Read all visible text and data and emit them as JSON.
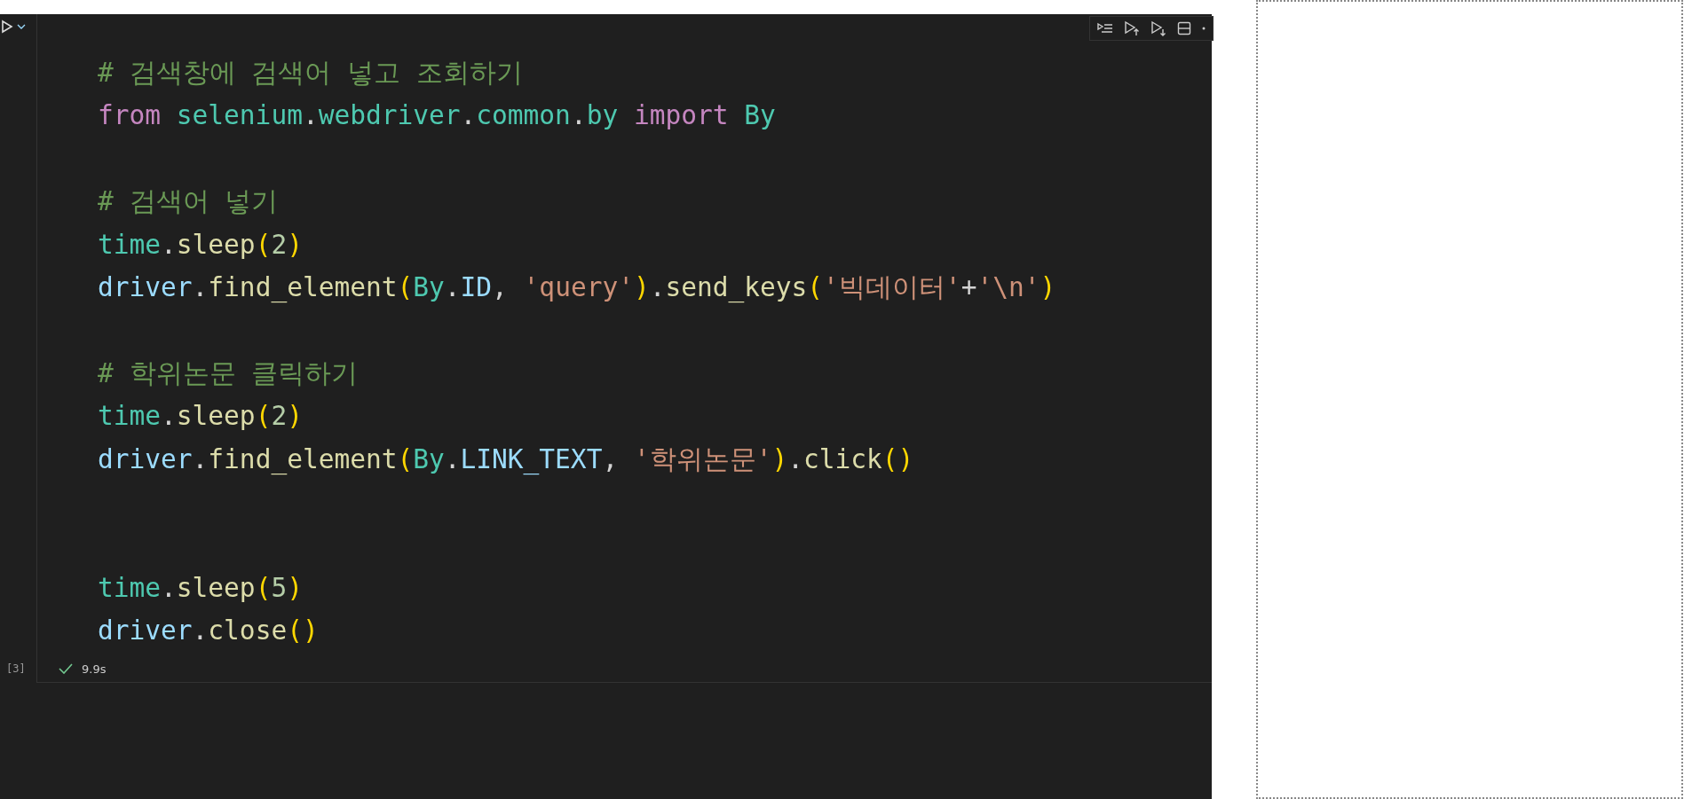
{
  "cell": {
    "execution_count": "[3]",
    "succeeded": true,
    "duration": "9.9s",
    "lines": [
      {
        "kind": "code",
        "tokens": [
          {
            "text": "# 검색창에 검색어 넣고 조회하기",
            "kind": "comment"
          }
        ]
      },
      {
        "kind": "code",
        "tokens": [
          {
            "text": "from ",
            "kind": "keyword"
          },
          {
            "text": "selenium",
            "kind": "module"
          },
          {
            "text": ".",
            "kind": "plain"
          },
          {
            "text": "webdriver",
            "kind": "module"
          },
          {
            "text": ".",
            "kind": "plain"
          },
          {
            "text": "common",
            "kind": "module"
          },
          {
            "text": ".",
            "kind": "plain"
          },
          {
            "text": "by ",
            "kind": "module"
          },
          {
            "text": "import ",
            "kind": "keyword"
          },
          {
            "text": "By",
            "kind": "module"
          }
        ]
      },
      {
        "kind": "blank"
      },
      {
        "kind": "code",
        "tokens": [
          {
            "text": "# 검색어 넣기",
            "kind": "comment"
          }
        ]
      },
      {
        "kind": "code",
        "tokens": [
          {
            "text": "time",
            "kind": "module"
          },
          {
            "text": ".",
            "kind": "plain"
          },
          {
            "text": "sleep",
            "kind": "function"
          },
          {
            "text": "(",
            "kind": "paren"
          },
          {
            "text": "2",
            "kind": "number"
          },
          {
            "text": ")",
            "kind": "paren"
          }
        ]
      },
      {
        "kind": "code",
        "tokens": [
          {
            "text": "driver",
            "kind": "variable"
          },
          {
            "text": ".",
            "kind": "plain"
          },
          {
            "text": "find_element",
            "kind": "function"
          },
          {
            "text": "(",
            "kind": "paren"
          },
          {
            "text": "By",
            "kind": "module"
          },
          {
            "text": ".",
            "kind": "plain"
          },
          {
            "text": "ID",
            "kind": "variable"
          },
          {
            "text": ", ",
            "kind": "plain"
          },
          {
            "text": "'query'",
            "kind": "string"
          },
          {
            "text": ")",
            "kind": "paren"
          },
          {
            "text": ".",
            "kind": "plain"
          },
          {
            "text": "send_keys",
            "kind": "function"
          },
          {
            "text": "(",
            "kind": "paren"
          },
          {
            "text": "'빅데이터'",
            "kind": "string"
          },
          {
            "text": "+",
            "kind": "plain"
          },
          {
            "text": "'\\n'",
            "kind": "string"
          },
          {
            "text": ")",
            "kind": "paren"
          }
        ]
      },
      {
        "kind": "blank"
      },
      {
        "kind": "code",
        "tokens": [
          {
            "text": "# 학위논문 클릭하기",
            "kind": "comment"
          }
        ]
      },
      {
        "kind": "code",
        "tokens": [
          {
            "text": "time",
            "kind": "module"
          },
          {
            "text": ".",
            "kind": "plain"
          },
          {
            "text": "sleep",
            "kind": "function"
          },
          {
            "text": "(",
            "kind": "paren"
          },
          {
            "text": "2",
            "kind": "number"
          },
          {
            "text": ")",
            "kind": "paren"
          }
        ]
      },
      {
        "kind": "code",
        "tokens": [
          {
            "text": "driver",
            "kind": "variable"
          },
          {
            "text": ".",
            "kind": "plain"
          },
          {
            "text": "find_element",
            "kind": "function"
          },
          {
            "text": "(",
            "kind": "paren"
          },
          {
            "text": "By",
            "kind": "module"
          },
          {
            "text": ".",
            "kind": "plain"
          },
          {
            "text": "LINK_TEXT",
            "kind": "variable"
          },
          {
            "text": ", ",
            "kind": "plain"
          },
          {
            "text": "'학위논문'",
            "kind": "string"
          },
          {
            "text": ")",
            "kind": "paren"
          },
          {
            "text": ".",
            "kind": "plain"
          },
          {
            "text": "click",
            "kind": "function"
          },
          {
            "text": "()",
            "kind": "paren"
          }
        ]
      },
      {
        "kind": "blank"
      },
      {
        "kind": "blank"
      },
      {
        "kind": "code",
        "tokens": [
          {
            "text": "time",
            "kind": "module"
          },
          {
            "text": ".",
            "kind": "plain"
          },
          {
            "text": "sleep",
            "kind": "function"
          },
          {
            "text": "(",
            "kind": "paren"
          },
          {
            "text": "5",
            "kind": "number"
          },
          {
            "text": ")",
            "kind": "paren"
          }
        ]
      },
      {
        "kind": "code",
        "tokens": [
          {
            "text": "driver",
            "kind": "variable"
          },
          {
            "text": ".close",
            "kind": "member"
          },
          {
            "text": "()",
            "kind": "paren"
          }
        ]
      }
    ]
  }
}
